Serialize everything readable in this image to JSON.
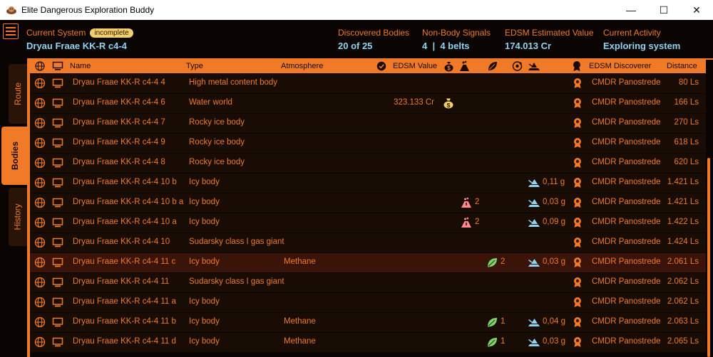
{
  "window": {
    "title": "Elite Dangerous Exploration Buddy",
    "app_icon": "buddy-app-icon",
    "minimize": "—",
    "maximize": "☐",
    "close": "✕"
  },
  "header": {
    "menu_icon": "hamburger-icon",
    "current_system_label": "Current System",
    "system_badge": "incomplete",
    "system_name": "Dryau Fraae KK-R c4-4",
    "discovered_label": "Discovered Bodies",
    "discovered_value": "20 of 25",
    "signals_label": "Non-Body Signals",
    "signals_value": "4  |  4 belts",
    "edsm_label": "EDSM Estimated Value",
    "edsm_value": "174.013 Cr",
    "activity_label": "Current Activity",
    "activity_value": "Exploring system"
  },
  "tabs": [
    {
      "label": "Route"
    },
    {
      "label": "Bodies"
    },
    {
      "label": "History"
    }
  ],
  "table": {
    "columns": {
      "name": "Name",
      "type": "Type",
      "atmosphere": "Atmosphere",
      "edsm_value": "EDSM Value",
      "edsm_discoverer": "EDSM Discoverer",
      "distance": "Distance"
    },
    "rows": [
      {
        "name": "Dryau Fraae KK-R c4-4 4",
        "type": "High metal content body",
        "atmosphere": "",
        "value": "",
        "money": false,
        "geo": "",
        "bio": "",
        "gravity": "",
        "discoverer": "CMDR Panostrede",
        "distance": "80 Ls"
      },
      {
        "name": "Dryau Fraae KK-R c4-4 6",
        "type": "Water world",
        "atmosphere": "",
        "value": "323.133 Cr",
        "money": true,
        "geo": "",
        "bio": "",
        "gravity": "",
        "discoverer": "CMDR Panostrede",
        "distance": "166 Ls"
      },
      {
        "name": "Dryau Fraae KK-R c4-4 7",
        "type": "Rocky ice body",
        "atmosphere": "",
        "value": "",
        "money": false,
        "geo": "",
        "bio": "",
        "gravity": "",
        "discoverer": "CMDR Panostrede",
        "distance": "270 Ls"
      },
      {
        "name": "Dryau Fraae KK-R c4-4 9",
        "type": "Rocky ice body",
        "atmosphere": "",
        "value": "",
        "money": false,
        "geo": "",
        "bio": "",
        "gravity": "",
        "discoverer": "CMDR Panostrede",
        "distance": "618 Ls"
      },
      {
        "name": "Dryau Fraae KK-R c4-4 8",
        "type": "Rocky ice body",
        "atmosphere": "",
        "value": "",
        "money": false,
        "geo": "",
        "bio": "",
        "gravity": "",
        "discoverer": "CMDR Panostrede",
        "distance": "620 Ls"
      },
      {
        "name": "Dryau Fraae KK-R c4-4 10 b",
        "type": "Icy body",
        "atmosphere": "",
        "value": "",
        "money": false,
        "geo": "",
        "bio": "",
        "gravity": "0,11 g",
        "discoverer": "CMDR Panostrede",
        "distance": "1.421 Ls"
      },
      {
        "name": "Dryau Fraae KK-R c4-4 10 b a",
        "type": "Icy body",
        "atmosphere": "",
        "value": "",
        "money": false,
        "geo": "2",
        "bio": "",
        "gravity": "0,03 g",
        "discoverer": "CMDR Panostrede",
        "distance": "1.421 Ls"
      },
      {
        "name": "Dryau Fraae KK-R c4-4 10 a",
        "type": "Icy body",
        "atmosphere": "",
        "value": "",
        "money": false,
        "geo": "2",
        "bio": "",
        "gravity": "0,09 g",
        "discoverer": "CMDR Panostrede",
        "distance": "1.422 Ls"
      },
      {
        "name": "Dryau Fraae KK-R c4-4 10",
        "type": "Sudarsky class I gas giant",
        "atmosphere": "",
        "value": "",
        "money": false,
        "geo": "",
        "bio": "",
        "gravity": "",
        "discoverer": "CMDR Panostrede",
        "distance": "1.424 Ls"
      },
      {
        "name": "Dryau Fraae KK-R c4-4 11 c",
        "type": "Icy body",
        "atmosphere": "Methane",
        "value": "",
        "money": false,
        "geo": "",
        "bio": "2",
        "gravity": "0,03 g",
        "discoverer": "CMDR Panostrede",
        "distance": "2.061 Ls",
        "selected": true
      },
      {
        "name": "Dryau Fraae KK-R c4-4 11",
        "type": "Sudarsky class I gas giant",
        "atmosphere": "",
        "value": "",
        "money": false,
        "geo": "",
        "bio": "",
        "gravity": "",
        "discoverer": "CMDR Panostrede",
        "distance": "2.062 Ls"
      },
      {
        "name": "Dryau Fraae KK-R c4-4 11 a",
        "type": "Icy body",
        "atmosphere": "",
        "value": "",
        "money": false,
        "geo": "",
        "bio": "",
        "gravity": "",
        "discoverer": "CMDR Panostrede",
        "distance": "2.062 Ls"
      },
      {
        "name": "Dryau Fraae KK-R c4-4 11 b",
        "type": "Icy body",
        "atmosphere": "Methane",
        "value": "",
        "money": false,
        "geo": "",
        "bio": "1",
        "gravity": "0,04 g",
        "discoverer": "CMDR Panostrede",
        "distance": "2.063 Ls"
      },
      {
        "name": "Dryau Fraae KK-R c4-4 11 d",
        "type": "Icy body",
        "atmosphere": "Methane",
        "value": "",
        "money": false,
        "geo": "",
        "bio": "1",
        "gravity": "0,03 g",
        "discoverer": "CMDR Panostrede",
        "distance": "2.065 Ls"
      }
    ]
  },
  "colors": {
    "accent": "#f07a28",
    "value_text": "#8fd3f0",
    "badge": "#f2cf6a",
    "geo_icon": "#ff8a8a",
    "bio_icon": "#7fd36a",
    "gravity_icon": "#8fd3f0"
  }
}
